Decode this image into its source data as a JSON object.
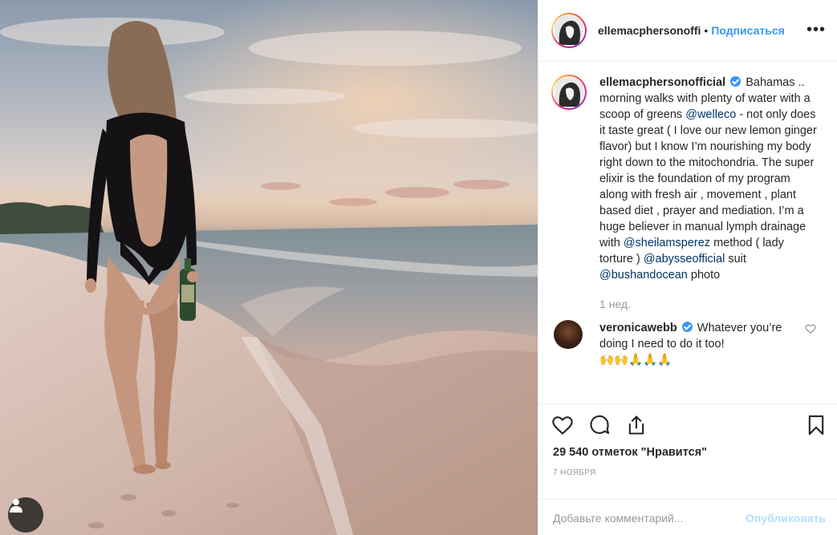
{
  "post": {
    "image_alt": "Woman walking on the beach at sunset holding a bottle",
    "header": {
      "username": "ellemacphersonoffi",
      "separator": "•",
      "follow_label": "Подписаться",
      "more_icon": "more-horizontal-icon",
      "more_label": "•••"
    },
    "caption": {
      "username": "ellemacphersonofficial",
      "verified": true,
      "parts": {
        "t1": "Bahamas .. morning walks with plenty of water with a scoop of greens",
        "m1": "@welleco",
        "t2": "- not only does it taste great ( I love our new lemon ginger flavor) but I know I’m nourishing my body right down to the mitochondria. The super elixir is the foundation of my program along with fresh air , movement , plant based diet , prayer and mediation. I’m a huge believer in manual lymph drainage with",
        "m2": "@sheilamsperez",
        "t3": "method ( lady torture )",
        "m3": "@abysseofficial",
        "t4": "suit",
        "m4": "@bushandocean",
        "t5": "photo"
      },
      "time": "1 нед."
    },
    "comments": [
      {
        "username": "veronicawebb",
        "verified": true,
        "text": "Whatever you’re doing I need to do it too!",
        "emoji": "🙌🙌🙏🙏🙏"
      }
    ],
    "actions": {
      "like_icon": "heart-icon",
      "comment_icon": "comment-icon",
      "share_icon": "share-icon",
      "save_icon": "bookmark-icon"
    },
    "likes": "29 540 отметок \"Нравится\"",
    "date": "7 ноября",
    "add_comment": {
      "placeholder": "Добавьте комментарий...",
      "publish_label": "Опубликовать"
    },
    "colors": {
      "link": "#3897f0",
      "mention": "#003569",
      "publish_disabled": "#b2dffc"
    }
  }
}
